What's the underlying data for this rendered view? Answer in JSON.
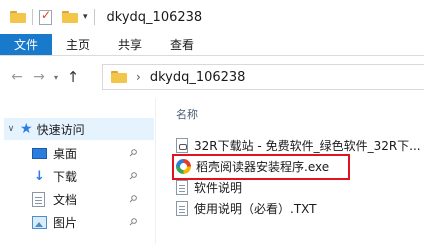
{
  "window": {
    "title": "dkydq_106238"
  },
  "quick_access_toolbar": {
    "icons": [
      "folder-icon",
      "properties-icon",
      "new-folder-icon"
    ],
    "dropdown_glyph": "▾"
  },
  "ribbon": {
    "tabs": [
      {
        "label": "文件",
        "active": true
      },
      {
        "label": "主页"
      },
      {
        "label": "共享"
      },
      {
        "label": "查看"
      }
    ],
    "active_color": "#1979ca"
  },
  "navigation": {
    "back_glyph": "←",
    "forward_glyph": "→",
    "recent_glyph": "▾",
    "up_glyph": "↑",
    "breadcrumb": [
      "dkydq_106238"
    ]
  },
  "sidebar": {
    "items": [
      {
        "label": "快速访问",
        "icon": "star-icon",
        "selected": true
      },
      {
        "label": "桌面",
        "icon": "desktop-icon",
        "pinned": true
      },
      {
        "label": "下载",
        "icon": "download-icon",
        "pinned": true
      },
      {
        "label": "文档",
        "icon": "document-icon",
        "pinned": true
      },
      {
        "label": "图片",
        "icon": "pictures-icon",
        "pinned": true
      }
    ]
  },
  "file_list": {
    "column_header": "名称",
    "files": [
      {
        "name": "32R下载站 - 免费软件_绿色软件_32R下...",
        "icon": "url-shortcut-icon"
      },
      {
        "name": "稻壳阅读器安装程序.exe",
        "icon": "installer-icon",
        "highlighted": true
      },
      {
        "name": "软件说明",
        "icon": "text-file-icon"
      },
      {
        "name": "使用说明（必看）.TXT",
        "icon": "text-file-icon"
      }
    ],
    "highlight_color": "#e0141e"
  }
}
